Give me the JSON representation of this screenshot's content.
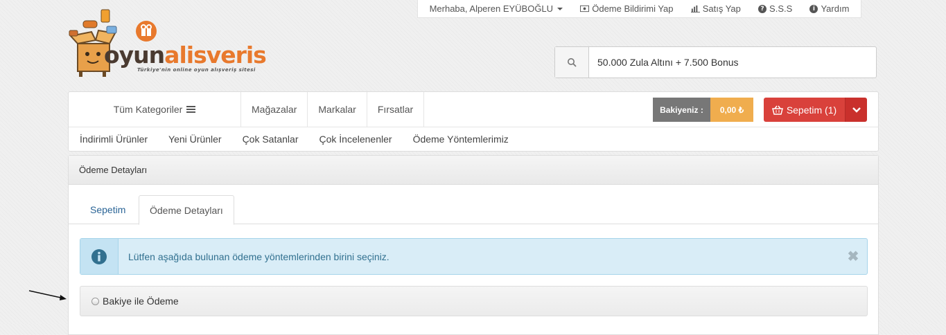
{
  "topbar": {
    "greeting": "Merhaba, Alperen EYÜBOĞLU",
    "payment_notice": "Ödeme Bildirimi Yap",
    "sell": "Satış Yap",
    "faq": "S.S.S",
    "help": "Yardım"
  },
  "logo": {
    "part1": "oyun",
    "part2": "alisveris",
    "tagline": "Türkiye'nin online oyun alışveriş sitesi"
  },
  "search": {
    "value": "50.000 Zula Altını + 7.500 Bonus"
  },
  "nav": {
    "all_categories": "Tüm Kategoriler",
    "links": [
      "Mağazalar",
      "Markalar",
      "Fırsatlar"
    ],
    "balance_label": "Bakiyeniz :",
    "balance_value": "0,00 ₺",
    "cart_label": "Sepetim (1)",
    "sub_links": [
      "İndirimli Ürünler",
      "Yeni Ürünler",
      "Çok Satanlar",
      "Çok İncelenenler",
      "Ödeme Yöntemlerimiz"
    ]
  },
  "panel": {
    "title": "Ödeme Detayları",
    "tabs": [
      "Sepetim",
      "Ödeme Detayları"
    ],
    "alert": "Lütfen aşağıda bulunan ödeme yöntemlerinden birini seçiniz.",
    "option": "Bakiye ile Ödeme"
  },
  "colors": {
    "accent_orange": "#f0ad4e",
    "cart_red": "#d9413b",
    "info_text": "#31708f",
    "link_blue": "#2a6496"
  }
}
